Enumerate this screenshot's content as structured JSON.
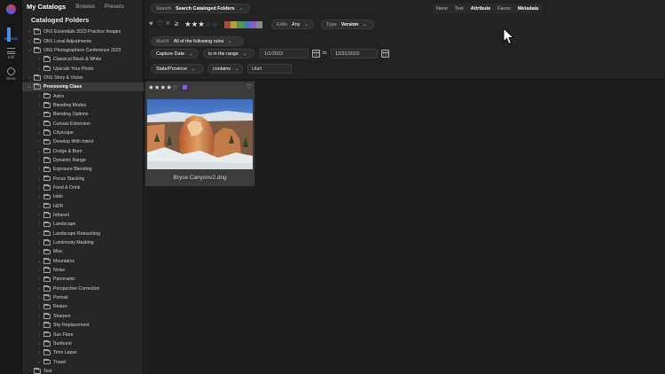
{
  "sidebar": {
    "tabs": [
      "My Catalogs",
      "Browse",
      "Presets"
    ],
    "heading": "Cataloged Folders",
    "items": [
      {
        "label": "ON1 Essentials 2023 Practice Images",
        "depth": 0,
        "expanded": false
      },
      {
        "label": "ON1 Local Adjustments",
        "depth": 0,
        "expanded": false
      },
      {
        "label": "ON1 Photographers Conference 2023",
        "depth": 0,
        "expanded": true
      },
      {
        "label": "Classical Black & White",
        "depth": 1,
        "expanded": false
      },
      {
        "label": "Upscale Your Photo",
        "depth": 1,
        "expanded": false
      },
      {
        "label": "ON1 Story & Vision",
        "depth": 0,
        "expanded": false
      },
      {
        "label": "Processing Class",
        "depth": 0,
        "expanded": true,
        "selected": true
      },
      {
        "label": "Astro",
        "depth": 1,
        "expanded": false
      },
      {
        "label": "Blending Modes",
        "depth": 1,
        "expanded": false
      },
      {
        "label": "Blending Options",
        "depth": 1,
        "expanded": false
      },
      {
        "label": "Canvas Extension",
        "depth": 1,
        "expanded": false
      },
      {
        "label": "Cityscape",
        "depth": 1,
        "expanded": false
      },
      {
        "label": "Develop With Intent",
        "depth": 1,
        "expanded": false
      },
      {
        "label": "Dodge & Burn",
        "depth": 1,
        "expanded": true
      },
      {
        "label": "Dynamic Range",
        "depth": 1,
        "expanded": false
      },
      {
        "label": "Exposure Blending",
        "depth": 1,
        "expanded": false
      },
      {
        "label": "Focus Stacking",
        "depth": 1,
        "expanded": false
      },
      {
        "label": "Food & Drink",
        "depth": 1,
        "expanded": false
      },
      {
        "label": "Halo",
        "depth": 1,
        "expanded": false
      },
      {
        "label": "HDR",
        "depth": 1,
        "expanded": false
      },
      {
        "label": "Infrared",
        "depth": 1,
        "expanded": false
      },
      {
        "label": "Landscape",
        "depth": 1,
        "expanded": false
      },
      {
        "label": "Landscape Retouching",
        "depth": 1,
        "expanded": false
      },
      {
        "label": "Luminosity Masking",
        "depth": 1,
        "expanded": false
      },
      {
        "label": "Misc",
        "depth": 1,
        "expanded": false
      },
      {
        "label": "Mountains",
        "depth": 1,
        "expanded": true
      },
      {
        "label": "Noise",
        "depth": 1,
        "expanded": false
      },
      {
        "label": "Panoramic",
        "depth": 1,
        "expanded": false
      },
      {
        "label": "Perspective Correction",
        "depth": 1,
        "expanded": false
      },
      {
        "label": "Portrait",
        "depth": 1,
        "expanded": false
      },
      {
        "label": "Resize",
        "depth": 1,
        "expanded": false
      },
      {
        "label": "Sharpen",
        "depth": 1,
        "expanded": false
      },
      {
        "label": "Sky Replacement",
        "depth": 1,
        "expanded": false
      },
      {
        "label": "Sun Flare",
        "depth": 1,
        "expanded": false
      },
      {
        "label": "Sunburst",
        "depth": 1,
        "expanded": false
      },
      {
        "label": "Time Lapse",
        "depth": 1,
        "expanded": false
      },
      {
        "label": "Travel",
        "depth": 1,
        "expanded": false
      },
      {
        "label": "Test",
        "depth": 0,
        "expanded": false
      }
    ]
  },
  "rail": {
    "browse_label": "Browse",
    "edit_label": "Edit",
    "more_label": "More"
  },
  "search": {
    "label": "Search",
    "scope": "Search Cataloged Folders"
  },
  "attribute_tabs": {
    "none": "None",
    "text": "Text",
    "attribute": "Attribute",
    "faces": "Faces",
    "metadata": "Metadata"
  },
  "rating_filter": {
    "operator": "≥",
    "stars": 3,
    "max_stars": 5,
    "color_labels": [
      "#b04545",
      "#b0a040",
      "#4f9a4f",
      "#3f7fb0",
      "#8a5bc9",
      "#888888"
    ]
  },
  "edits": {
    "label": "Edits",
    "value": "Any"
  },
  "type": {
    "label": "Type",
    "value": "Version"
  },
  "match": {
    "label": "Match",
    "value": "All of the following rules"
  },
  "rule1": {
    "field": "Capture Date",
    "operator": "is in the range",
    "from": "1/1/2023",
    "to_label": "to",
    "to": "12/31/2023"
  },
  "rule2": {
    "field": "State/Province",
    "operator": "contains",
    "value": "Utah"
  },
  "thumbnail": {
    "rating": 4,
    "max_rating": 5,
    "color_label": "#8f5bd9",
    "filename": "Bryce Canyonv2.dng"
  }
}
